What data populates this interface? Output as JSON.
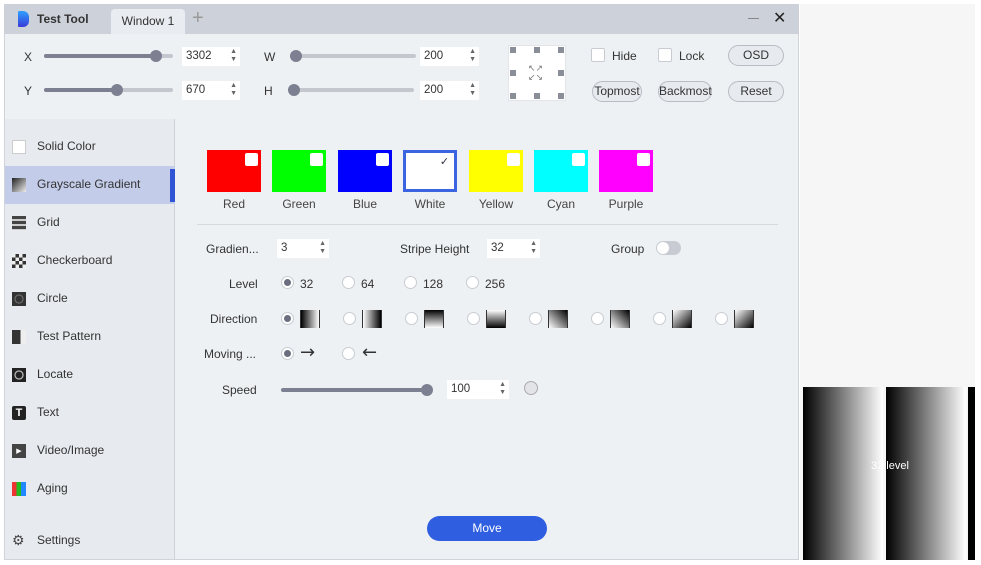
{
  "app": {
    "title": "Test Tool",
    "tab": "Window 1"
  },
  "controls": {
    "x": {
      "label": "X",
      "value": "3302",
      "fraction": 0.9
    },
    "y": {
      "label": "Y",
      "value": "670",
      "fraction": 0.57
    },
    "w": {
      "label": "W",
      "value": "200",
      "fraction": 0.05
    },
    "h": {
      "label": "H",
      "value": "200",
      "fraction": 0.04
    },
    "hide": "Hide",
    "lock": "Lock",
    "osd": "OSD",
    "topmost": "Topmost",
    "backmost": "Backmost",
    "reset": "Reset"
  },
  "sidebar": {
    "items": [
      {
        "label": "Solid Color"
      },
      {
        "label": "Grayscale Gradient"
      },
      {
        "label": "Grid"
      },
      {
        "label": "Checkerboard"
      },
      {
        "label": "Circle"
      },
      {
        "label": "Test Pattern"
      },
      {
        "label": "Locate"
      },
      {
        "label": "Text"
      },
      {
        "label": "Video/Image"
      },
      {
        "label": "Aging"
      }
    ],
    "settings": "Settings"
  },
  "colors": [
    {
      "label": "Red",
      "hex": "#ff0000",
      "checked": false
    },
    {
      "label": "Green",
      "hex": "#00ff00",
      "checked": false
    },
    {
      "label": "Blue",
      "hex": "#0000ff",
      "checked": false
    },
    {
      "label": "White",
      "hex": "#ffffff",
      "checked": true
    },
    {
      "label": "Yellow",
      "hex": "#ffff00",
      "checked": false
    },
    {
      "label": "Cyan",
      "hex": "#00ffff",
      "checked": false
    },
    {
      "label": "Purple",
      "hex": "#ff00ff",
      "checked": false
    }
  ],
  "check_mark": "✓",
  "form": {
    "gradient_label": "Gradien...",
    "gradient_value": "3",
    "stripe_label": "Stripe Height",
    "stripe_value": "32",
    "group_label": "Group",
    "level_label": "Level",
    "levels": [
      "32",
      "64",
      "128",
      "256"
    ],
    "direction_label": "Direction",
    "moving_label": "Moving ...",
    "right_arrow": "→",
    "left_arrow": "←",
    "speed_label": "Speed",
    "speed_value": "100"
  },
  "move_button": "Move",
  "preview": {
    "label": "32 level"
  }
}
